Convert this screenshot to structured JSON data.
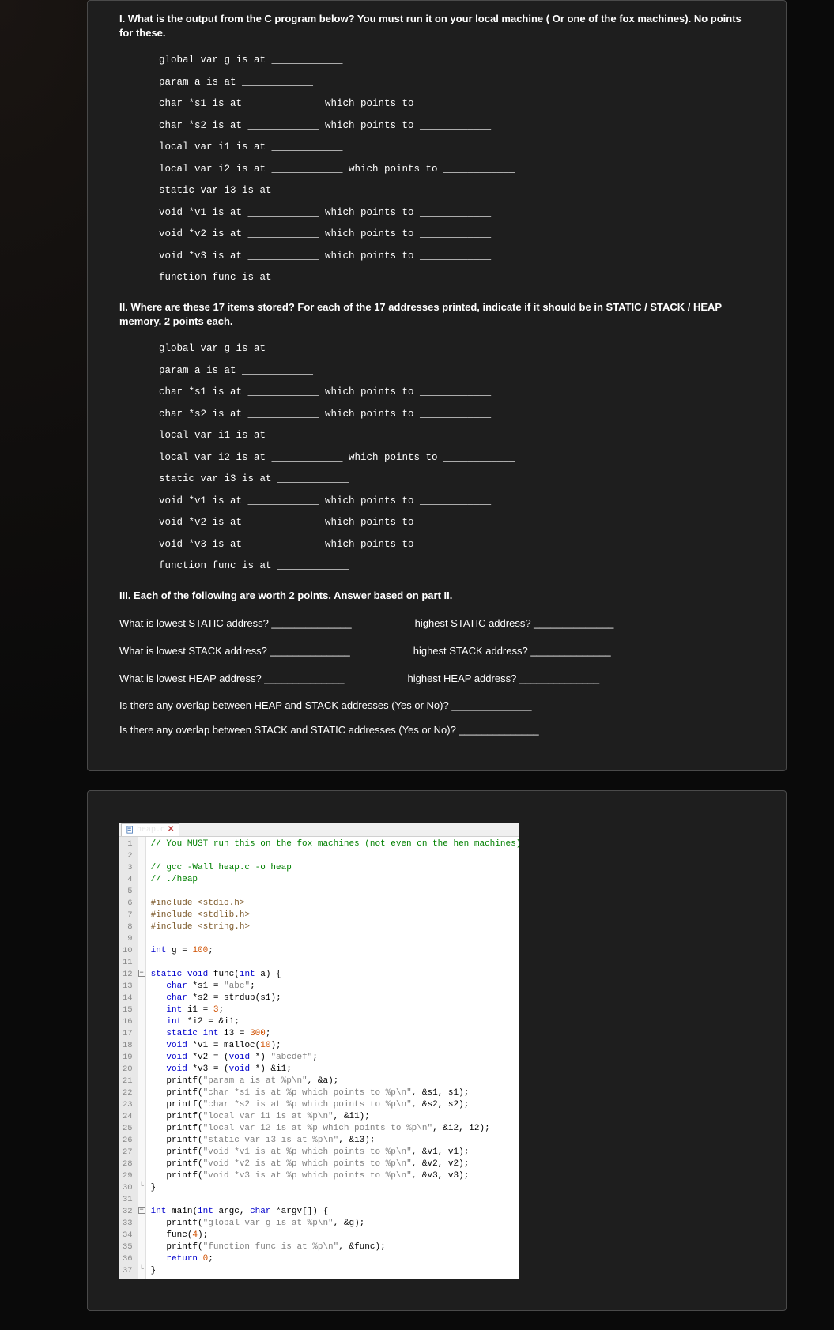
{
  "part1": {
    "heading": "I. What is the output from the C program below? You must run it on your local machine ( Or one of the fox machines). No points for these.",
    "lines": [
      "global var g is at ____________",
      "param a is at ____________",
      "char *s1 is at ____________ which points to ____________",
      "char *s2 is at ____________ which points to ____________",
      "local var i1 is at ____________",
      "local var i2 is at ____________ which points to ____________",
      "static var i3 is at ____________",
      "void *v1 is at ____________ which points to ____________",
      "void *v2 is at ____________ which points to ____________",
      "void *v3 is at ____________ which points to ____________",
      "function func is at ____________"
    ]
  },
  "part2": {
    "heading": "II. Where are these 17 items stored? For each of the 17 addresses printed, indicate if it should be in STATIC / STACK / HEAP memory. 2 points each.",
    "lines": [
      "global var g is at ____________",
      "param a is at ____________",
      "char *s1 is at ____________ which points to ____________",
      "char *s2 is at ____________ which points to ____________",
      "local var i1 is at ____________",
      "local var i2 is at ____________ which points to ____________",
      "static var i3 is at ____________",
      "void *v1 is at ____________ which points to ____________",
      "void *v2 is at ____________ which points to ____________",
      "void *v3 is at ____________ which points to ____________",
      "function func is at ____________"
    ]
  },
  "part3": {
    "heading": "III. Each of the following are worth 2 points. Answer based on part II.",
    "rows": [
      [
        "What is lowest STATIC address? ______________",
        "highest STATIC address? ______________"
      ],
      [
        "What is lowest STACK address? ______________",
        "highest STACK address? ______________"
      ],
      [
        "What is lowest HEAP address? ______________",
        "highest HEAP address? ______________"
      ]
    ],
    "q_overlap1": "Is there any overlap between HEAP and STACK addresses (Yes or No)? ______________",
    "q_overlap2": "Is there any overlap between STACK and STATIC addresses (Yes or No)? ______________"
  },
  "editor": {
    "filename": "heap.c",
    "line_count": 37,
    "fold_markers": {
      "12": "⊟",
      "30": "└",
      "32": "⊟",
      "37": "└"
    },
    "code_tokens": [
      [
        [
          "comment",
          "// You MUST run this on the fox machines (not even on the hen machines)"
        ]
      ],
      [],
      [
        [
          "comment",
          "// gcc -Wall heap.c -o heap"
        ]
      ],
      [
        [
          "comment",
          "// ./heap"
        ]
      ],
      [],
      [
        [
          "pre",
          "#include <stdio.h>"
        ]
      ],
      [
        [
          "pre",
          "#include <stdlib.h>"
        ]
      ],
      [
        [
          "pre",
          "#include <string.h>"
        ]
      ],
      [],
      [
        [
          "keyword",
          "int"
        ],
        [
          "plain",
          " g "
        ],
        [
          "op",
          "="
        ],
        [
          "plain",
          " "
        ],
        [
          "num",
          "100"
        ],
        [
          "plain",
          ";"
        ]
      ],
      [],
      [
        [
          "keyword",
          "static void"
        ],
        [
          "plain",
          " "
        ],
        [
          "func",
          "func"
        ],
        [
          "plain",
          "("
        ],
        [
          "keyword",
          "int"
        ],
        [
          "plain",
          " a) {"
        ]
      ],
      [
        [
          "plain",
          "   "
        ],
        [
          "keyword",
          "char"
        ],
        [
          "plain",
          " *s1 "
        ],
        [
          "op",
          "="
        ],
        [
          "plain",
          " "
        ],
        [
          "string",
          "\"abc\""
        ],
        [
          "plain",
          ";"
        ]
      ],
      [
        [
          "plain",
          "   "
        ],
        [
          "keyword",
          "char"
        ],
        [
          "plain",
          " *s2 "
        ],
        [
          "op",
          "="
        ],
        [
          "plain",
          " strdup(s1);"
        ]
      ],
      [
        [
          "plain",
          "   "
        ],
        [
          "keyword",
          "int"
        ],
        [
          "plain",
          " i1 "
        ],
        [
          "op",
          "="
        ],
        [
          "plain",
          " "
        ],
        [
          "num",
          "3"
        ],
        [
          "plain",
          ";"
        ]
      ],
      [
        [
          "plain",
          "   "
        ],
        [
          "keyword",
          "int"
        ],
        [
          "plain",
          " *i2 "
        ],
        [
          "op",
          "="
        ],
        [
          "plain",
          " "
        ],
        [
          "op",
          "&"
        ],
        [
          "plain",
          "i1;"
        ]
      ],
      [
        [
          "plain",
          "   "
        ],
        [
          "keyword",
          "static int"
        ],
        [
          "plain",
          " i3 "
        ],
        [
          "op",
          "="
        ],
        [
          "plain",
          " "
        ],
        [
          "num",
          "300"
        ],
        [
          "plain",
          ";"
        ]
      ],
      [
        [
          "plain",
          "   "
        ],
        [
          "keyword",
          "void"
        ],
        [
          "plain",
          " *v1 "
        ],
        [
          "op",
          "="
        ],
        [
          "plain",
          " malloc("
        ],
        [
          "num",
          "10"
        ],
        [
          "plain",
          ");"
        ]
      ],
      [
        [
          "plain",
          "   "
        ],
        [
          "keyword",
          "void"
        ],
        [
          "plain",
          " *v2 "
        ],
        [
          "op",
          "="
        ],
        [
          "plain",
          " ("
        ],
        [
          "keyword",
          "void"
        ],
        [
          "plain",
          " *) "
        ],
        [
          "string",
          "\"abcdef\""
        ],
        [
          "plain",
          ";"
        ]
      ],
      [
        [
          "plain",
          "   "
        ],
        [
          "keyword",
          "void"
        ],
        [
          "plain",
          " *v3 "
        ],
        [
          "op",
          "="
        ],
        [
          "plain",
          " ("
        ],
        [
          "keyword",
          "void"
        ],
        [
          "plain",
          " *) "
        ],
        [
          "op",
          "&"
        ],
        [
          "plain",
          "i1;"
        ]
      ],
      [
        [
          "plain",
          "   printf("
        ],
        [
          "string",
          "\"param a is at %p\\n\""
        ],
        [
          "plain",
          ", "
        ],
        [
          "op",
          "&"
        ],
        [
          "plain",
          "a);"
        ]
      ],
      [
        [
          "plain",
          "   printf("
        ],
        [
          "string",
          "\"char *s1 is at %p which points to %p\\n\""
        ],
        [
          "plain",
          ", "
        ],
        [
          "op",
          "&"
        ],
        [
          "plain",
          "s1, s1);"
        ]
      ],
      [
        [
          "plain",
          "   printf("
        ],
        [
          "string",
          "\"char *s2 is at %p which points to %p\\n\""
        ],
        [
          "plain",
          ", "
        ],
        [
          "op",
          "&"
        ],
        [
          "plain",
          "s2, s2);"
        ]
      ],
      [
        [
          "plain",
          "   printf("
        ],
        [
          "string",
          "\"local var i1 is at %p\\n\""
        ],
        [
          "plain",
          ", "
        ],
        [
          "op",
          "&"
        ],
        [
          "plain",
          "i1);"
        ]
      ],
      [
        [
          "plain",
          "   printf("
        ],
        [
          "string",
          "\"local var i2 is at %p which points to %p\\n\""
        ],
        [
          "plain",
          ", "
        ],
        [
          "op",
          "&"
        ],
        [
          "plain",
          "i2, i2);"
        ]
      ],
      [
        [
          "plain",
          "   printf("
        ],
        [
          "string",
          "\"static var i3 is at %p\\n\""
        ],
        [
          "plain",
          ", "
        ],
        [
          "op",
          "&"
        ],
        [
          "plain",
          "i3);"
        ]
      ],
      [
        [
          "plain",
          "   printf("
        ],
        [
          "string",
          "\"void *v1 is at %p which points to %p\\n\""
        ],
        [
          "plain",
          ", "
        ],
        [
          "op",
          "&"
        ],
        [
          "plain",
          "v1, v1);"
        ]
      ],
      [
        [
          "plain",
          "   printf("
        ],
        [
          "string",
          "\"void *v2 is at %p which points to %p\\n\""
        ],
        [
          "plain",
          ", "
        ],
        [
          "op",
          "&"
        ],
        [
          "plain",
          "v2, v2);"
        ]
      ],
      [
        [
          "plain",
          "   printf("
        ],
        [
          "string",
          "\"void *v3 is at %p which points to %p\\n\""
        ],
        [
          "plain",
          ", "
        ],
        [
          "op",
          "&"
        ],
        [
          "plain",
          "v3, v3);"
        ]
      ],
      [
        [
          "plain",
          "}"
        ]
      ],
      [],
      [
        [
          "keyword",
          "int"
        ],
        [
          "plain",
          " "
        ],
        [
          "func",
          "main"
        ],
        [
          "plain",
          "("
        ],
        [
          "keyword",
          "int"
        ],
        [
          "plain",
          " argc, "
        ],
        [
          "keyword",
          "char"
        ],
        [
          "plain",
          " *argv[]) {"
        ]
      ],
      [
        [
          "plain",
          "   printf("
        ],
        [
          "string",
          "\"global var g is at %p\\n\""
        ],
        [
          "plain",
          ", "
        ],
        [
          "op",
          "&"
        ],
        [
          "plain",
          "g);"
        ]
      ],
      [
        [
          "plain",
          "   func("
        ],
        [
          "num",
          "4"
        ],
        [
          "plain",
          ");"
        ]
      ],
      [
        [
          "plain",
          "   printf("
        ],
        [
          "string",
          "\"function func is at %p\\n\""
        ],
        [
          "plain",
          ", "
        ],
        [
          "op",
          "&"
        ],
        [
          "plain",
          "func);"
        ]
      ],
      [
        [
          "plain",
          "   "
        ],
        [
          "keyword",
          "return"
        ],
        [
          "plain",
          " "
        ],
        [
          "num",
          "0"
        ],
        [
          "plain",
          ";"
        ]
      ],
      [
        [
          "plain",
          "}"
        ]
      ]
    ]
  }
}
